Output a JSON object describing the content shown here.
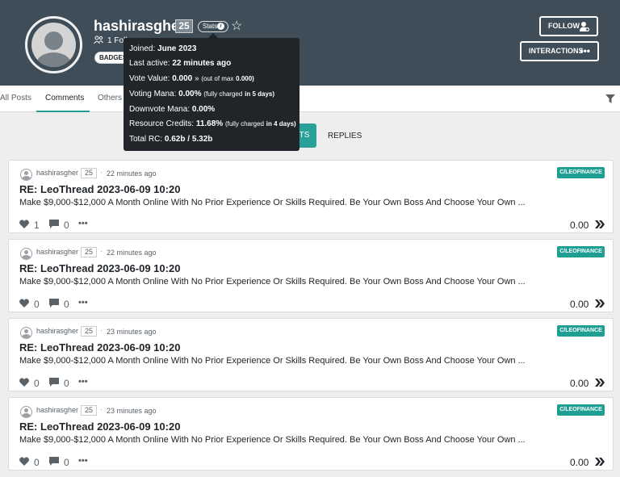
{
  "profile": {
    "username": "hashirasgher",
    "reputation": "25",
    "stats_label": "Stats",
    "followers_text": "1 Foll",
    "badges_label": "BADGES &"
  },
  "actions": {
    "follow_label": "FOLLOW",
    "interactions_label": "INTERACTIONS"
  },
  "tabs": [
    {
      "label": "All Posts"
    },
    {
      "label": "Comments"
    },
    {
      "label": "Others"
    }
  ],
  "subtabs": {
    "active_label": "TS",
    "replies_label": "REPLIES"
  },
  "tooltip": {
    "joined_label": "Joined:",
    "joined_value": "June 2023",
    "active_label": "Last active:",
    "active_value": "22 minutes ago",
    "vote_label": "Vote Value:",
    "vote_value": "0.000",
    "vote_max_pre": "(out of max",
    "vote_max_value": "0.000)",
    "mana_label": "Voting Mana:",
    "mana_value": "0.00%",
    "mana_note_pre": "(fully charged",
    "mana_note_value": "in 5 days)",
    "down_label": "Downvote Mana:",
    "down_value": "0.00%",
    "rc_label": "Resource Credits:",
    "rc_value": "11.68%",
    "rc_note_pre": "(fully charged",
    "rc_note_value": "in 4 days)",
    "total_label": "Total RC:",
    "total_value": "0.62b / 5.32b"
  },
  "posts": [
    {
      "user": "hashirasgher",
      "rep": "25",
      "time": "22 minutes ago",
      "tag": "C/LEOFINANCE",
      "title": "RE: LeoThread 2023-06-09 10:20",
      "excerpt": "Make $9,000-$12,000 A Month Online With No Prior Experience Or Skills Required. Be Your Own Boss And Choose Your Own ...",
      "likes": "1",
      "comments": "0",
      "payout": "0.00"
    },
    {
      "user": "hashirasgher",
      "rep": "25",
      "time": "22 minutes ago",
      "tag": "C/LEOFINANCE",
      "title": "RE: LeoThread 2023-06-09 10:20",
      "excerpt": "Make $9,000-$12,000 A Month Online With No Prior Experience Or Skills Required. Be Your Own Boss And Choose Your Own ...",
      "likes": "0",
      "comments": "0",
      "payout": "0.00"
    },
    {
      "user": "hashirasgher",
      "rep": "25",
      "time": "23 minutes ago",
      "tag": "C/LEOFINANCE",
      "title": "RE: LeoThread 2023-06-09 10:20",
      "excerpt": "Make $9,000-$12,000 A Month Online With No Prior Experience Or Skills Required. Be Your Own Boss And Choose Your Own ...",
      "likes": "0",
      "comments": "0",
      "payout": "0.00"
    },
    {
      "user": "hashirasgher",
      "rep": "25",
      "time": "23 minutes ago",
      "tag": "C/LEOFINANCE",
      "title": "RE: LeoThread 2023-06-09 10:20",
      "excerpt": "Make $9,000-$12,000 A Month Online With No Prior Experience Or Skills Required. Be Your Own Boss And Choose Your Own ...",
      "likes": "0",
      "comments": "0",
      "payout": "0.00"
    }
  ],
  "colors": {
    "header_bg": "#3e4d57",
    "accent": "#1f9e93",
    "tooltip_bg": "#212529",
    "page_bg": "#eeeeee"
  },
  "icons": {
    "star": "star-icon",
    "info": "info-icon",
    "followers": "followers-icon",
    "follow": "user-add-icon",
    "interactions": "more-icon",
    "filter": "filter-icon",
    "heart": "heart-icon",
    "comment": "comment-icon",
    "hive": "hive-icon"
  }
}
